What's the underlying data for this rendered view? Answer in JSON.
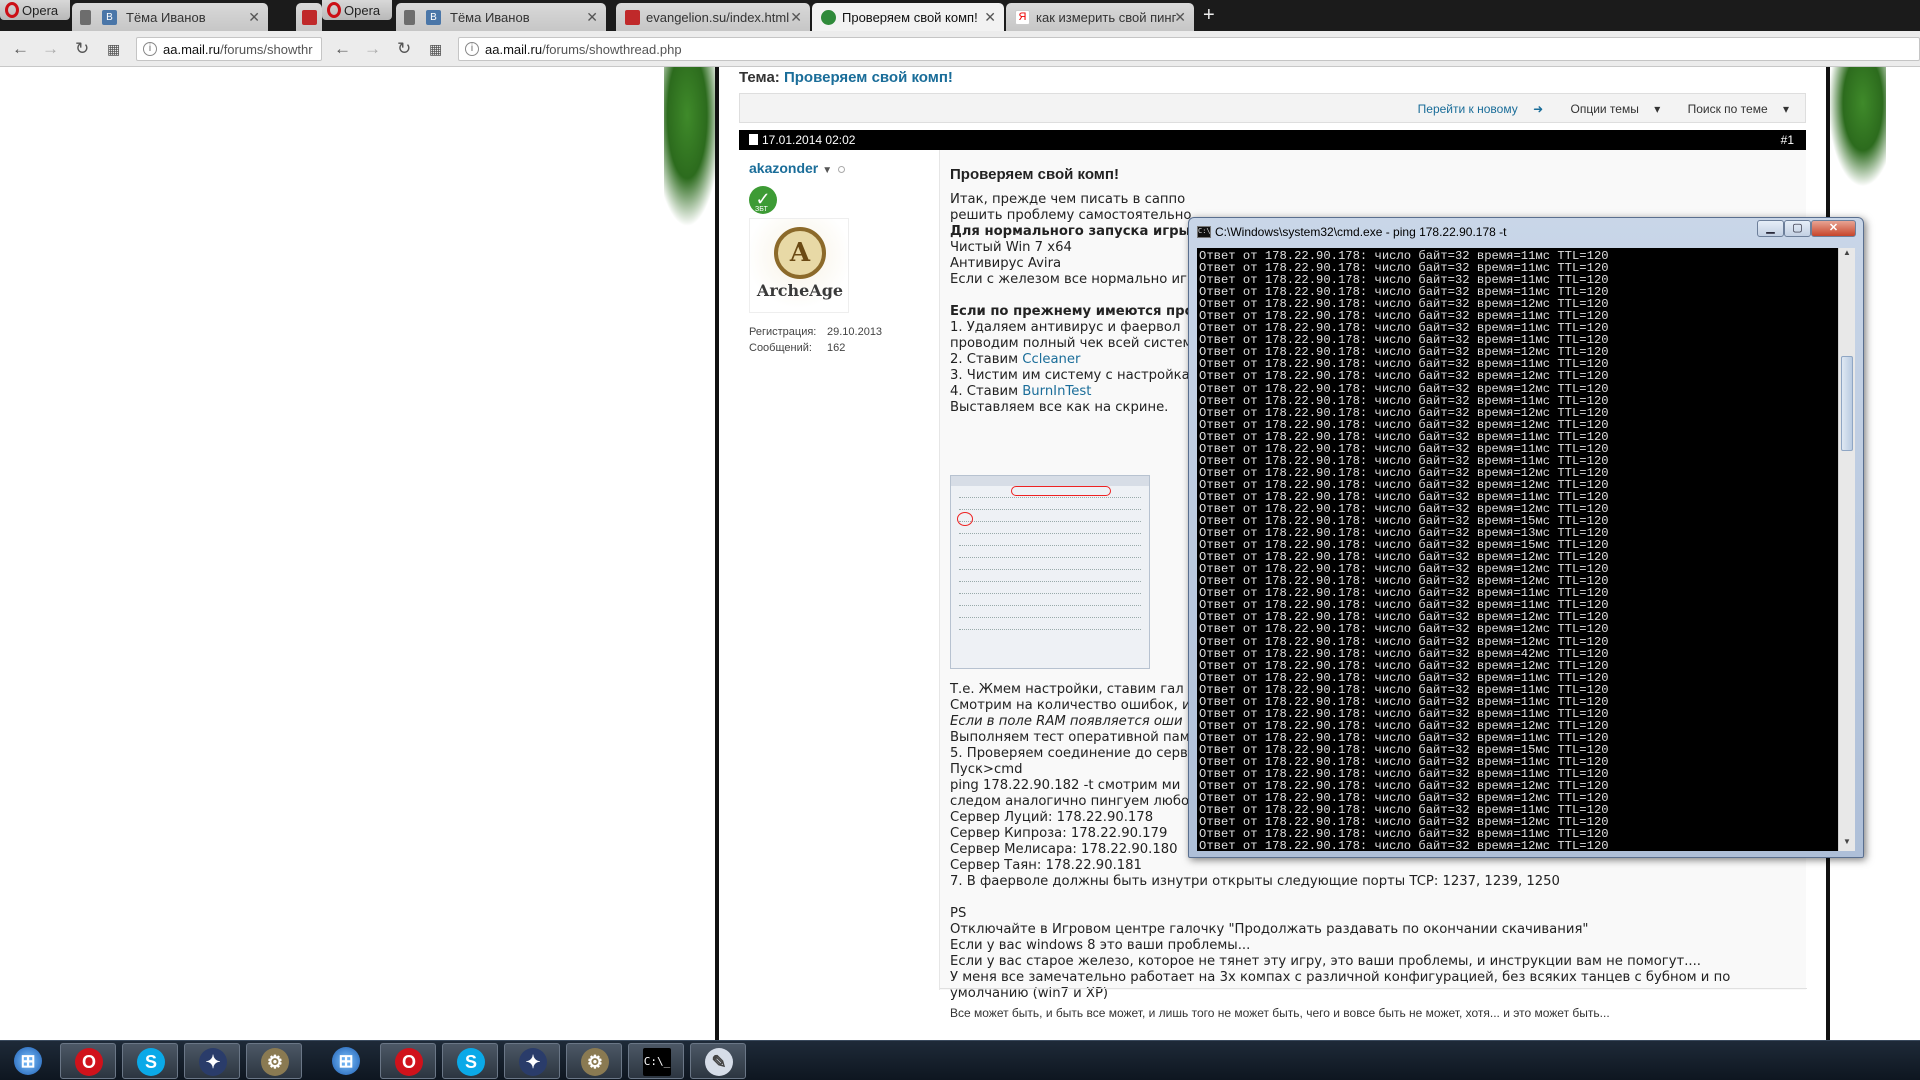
{
  "browser": {
    "opera_label": "Opera",
    "tabs": [
      {
        "label": "Тёма Иванов"
      },
      {
        "label": "Тёма Иванов"
      },
      {
        "label": "evangelion.su/index.html"
      },
      {
        "label": "Проверяем свой комп!"
      },
      {
        "label": "как измерить свой пинг"
      }
    ],
    "url_left": {
      "host": "aa.mail.ru",
      "path": "/forums/showthr"
    },
    "url_right": {
      "host": "aa.mail.ru",
      "path": "/forums/showthread.php"
    }
  },
  "forum": {
    "topic_prefix": "Тема:",
    "topic_title": "Проверяем свой комп!",
    "links": {
      "goto_new": "Перейти к новому",
      "thread_options": "Опции темы",
      "search_thread": "Поиск по теме"
    },
    "post": {
      "date": "17.01.2014 02:02",
      "number": "#1",
      "author": "akazonder",
      "badge_text": "ЗБТ",
      "avatar_word": "ArcheAge",
      "reg_label": "Регистрация:",
      "reg_value": "29.10.2013",
      "msgs_label": "Сообщений:",
      "msgs_value": "162",
      "title": "Проверяем свой комп!",
      "lines_top": [
        {
          "t": "Итак, прежде чем писать в саппо",
          "s": ""
        },
        {
          "t": "решить проблему самостоятельно",
          "s": ""
        },
        {
          "t": "Для нормального запуска игры",
          "s": "b"
        },
        {
          "t": "Чистый Win 7 x64",
          "s": ""
        },
        {
          "t": "Антивирус Avira",
          "s": ""
        },
        {
          "t": "Если с железом все нормально иг",
          "s": ""
        },
        {
          "t": "",
          "s": ""
        },
        {
          "t": "Если по прежнему имеются про",
          "s": "b"
        },
        {
          "t": "1. Удаляем антивирус и фаервол",
          "s": ""
        },
        {
          "t": "проводим полный чек всей систем",
          "s": ""
        }
      ],
      "step2_prefix": "2. Ставим ",
      "step2_link": "Ccleaner",
      "step3": "3. Чистим им систему с настройка",
      "step4_prefix": "4. Ставим ",
      "step4_link": "BurnInTest",
      "step4_after": "Выставляем все как на скрине.",
      "lines_bottom": [
        {
          "t": "Т.е. Жмем настройки, ставим гал",
          "s": ""
        },
        {
          "t": "Смотрим на количество ошибок, и",
          "s": ""
        },
        {
          "t": "Если в поле RAM появляется оши",
          "s": "i"
        },
        {
          "t": "Выполняем тест оперативной памя",
          "s": ""
        },
        {
          "t": "5. Проверяем соединение до серв",
          "s": ""
        },
        {
          "t": "Пуск>cmd",
          "s": ""
        },
        {
          "t": "ping 178.22.90.182 -t смотрим ми",
          "s": ""
        },
        {
          "t": "следом аналогично пингуем любо",
          "s": ""
        },
        {
          "t": "Сервер Луций: 178.22.90.178",
          "s": ""
        },
        {
          "t": "Сервер Кипроза: 178.22.90.179",
          "s": ""
        },
        {
          "t": "Сервер Мелисара: 178.22.90.180",
          "s": ""
        },
        {
          "t": "Сервер Таян: 178.22.90.181",
          "s": ""
        },
        {
          "t": "7. В фаерволе должны быть изнутри открыты следующие порты TCP: 1237, 1239, 1250",
          "s": ""
        },
        {
          "t": "",
          "s": ""
        },
        {
          "t": "PS",
          "s": ""
        },
        {
          "t": "Отключайте в Игровом центре галочку \"Продолжать раздавать по окончании скачивания\"",
          "s": ""
        },
        {
          "t": "Если у вас windows 8 это ваши проблемы...",
          "s": ""
        },
        {
          "t": "Если у вас старое железо, которое не тянет эту игру, это ваши проблемы, и инструкции вам не помогут....",
          "s": ""
        },
        {
          "t": "У меня все замечательно работает на 3х компах с различной конфигурацией, без всяких танцев с бубном и по",
          "s": ""
        },
        {
          "t": "умолчанию (win7 и XP)",
          "s": ""
        }
      ],
      "signature": "Все может быть, и быть все может, и лишь того не может быть, чего и вовсе быть не может, хотя... и это может быть..."
    }
  },
  "cmd": {
    "title": "C:\\Windows\\system32\\cmd.exe - ping  178.22.90.178 -t",
    "lines": [
      "Ответ от 178.22.90.178: число байт=32 время=11мс TTL=120",
      "Ответ от 178.22.90.178: число байт=32 время=11мс TTL=120",
      "Ответ от 178.22.90.178: число байт=32 время=11мс TTL=120",
      "Ответ от 178.22.90.178: число байт=32 время=11мс TTL=120",
      "Ответ от 178.22.90.178: число байт=32 время=12мс TTL=120",
      "Ответ от 178.22.90.178: число байт=32 время=11мс TTL=120",
      "Ответ от 178.22.90.178: число байт=32 время=11мс TTL=120",
      "Ответ от 178.22.90.178: число байт=32 время=11мс TTL=120",
      "Ответ от 178.22.90.178: число байт=32 время=12мс TTL=120",
      "Ответ от 178.22.90.178: число байт=32 время=11мс TTL=120",
      "Ответ от 178.22.90.178: число байт=32 время=12мс TTL=120",
      "Ответ от 178.22.90.178: число байт=32 время=12мс TTL=120",
      "Ответ от 178.22.90.178: число байт=32 время=11мс TTL=120",
      "Ответ от 178.22.90.178: число байт=32 время=12мс TTL=120",
      "Ответ от 178.22.90.178: число байт=32 время=12мс TTL=120",
      "Ответ от 178.22.90.178: число байт=32 время=11мс TTL=120",
      "Ответ от 178.22.90.178: число байт=32 время=11мс TTL=120",
      "Ответ от 178.22.90.178: число байт=32 время=11мс TTL=120",
      "Ответ от 178.22.90.178: число байт=32 время=12мс TTL=120",
      "Ответ от 178.22.90.178: число байт=32 время=12мс TTL=120",
      "Ответ от 178.22.90.178: число байт=32 время=11мс TTL=120",
      "Ответ от 178.22.90.178: число байт=32 время=12мс TTL=120",
      "Ответ от 178.22.90.178: число байт=32 время=15мс TTL=120",
      "Ответ от 178.22.90.178: число байт=32 время=13мс TTL=120",
      "Ответ от 178.22.90.178: число байт=32 время=15мс TTL=120",
      "Ответ от 178.22.90.178: число байт=32 время=12мс TTL=120",
      "Ответ от 178.22.90.178: число байт=32 время=12мс TTL=120",
      "Ответ от 178.22.90.178: число байт=32 время=12мс TTL=120",
      "Ответ от 178.22.90.178: число байт=32 время=11мс TTL=120",
      "Ответ от 178.22.90.178: число байт=32 время=11мс TTL=120",
      "Ответ от 178.22.90.178: число байт=32 время=12мс TTL=120",
      "Ответ от 178.22.90.178: число байт=32 время=12мс TTL=120",
      "Ответ от 178.22.90.178: число байт=32 время=12мс TTL=120",
      "Ответ от 178.22.90.178: число байт=32 время=42мс TTL=120",
      "Ответ от 178.22.90.178: число байт=32 время=12мс TTL=120",
      "Ответ от 178.22.90.178: число байт=32 время=11мс TTL=120",
      "Ответ от 178.22.90.178: число байт=32 время=11мс TTL=120",
      "Ответ от 178.22.90.178: число байт=32 время=11мс TTL=120",
      "Ответ от 178.22.90.178: число байт=32 время=11мс TTL=120",
      "Ответ от 178.22.90.178: число байт=32 время=12мс TTL=120",
      "Ответ от 178.22.90.178: число байт=32 время=11мс TTL=120",
      "Ответ от 178.22.90.178: число байт=32 время=15мс TTL=120",
      "Ответ от 178.22.90.178: число байт=32 время=11мс TTL=120",
      "Ответ от 178.22.90.178: число байт=32 время=11мс TTL=120",
      "Ответ от 178.22.90.178: число байт=32 время=12мс TTL=120",
      "Ответ от 178.22.90.178: число байт=32 время=12мс TTL=120",
      "Ответ от 178.22.90.178: число байт=32 время=11мс TTL=120",
      "Ответ от 178.22.90.178: число байт=32 время=12мс TTL=120",
      "Ответ от 178.22.90.178: число байт=32 время=11мс TTL=120",
      "Ответ от 178.22.90.178: число байт=32 время=12мс TTL=120",
      "Ответ от 178.22.90.178: число байт=32 время=11мс TTL=120",
      "Ответ от 178.22.90.178: число байт=32 время=11мс TTL=120"
    ]
  },
  "taskbar": {
    "items": [
      "start",
      "opera",
      "skype",
      "launcher",
      "settings",
      "start",
      "opera",
      "skype",
      "launcher",
      "settings",
      "cmd",
      "paint"
    ]
  }
}
